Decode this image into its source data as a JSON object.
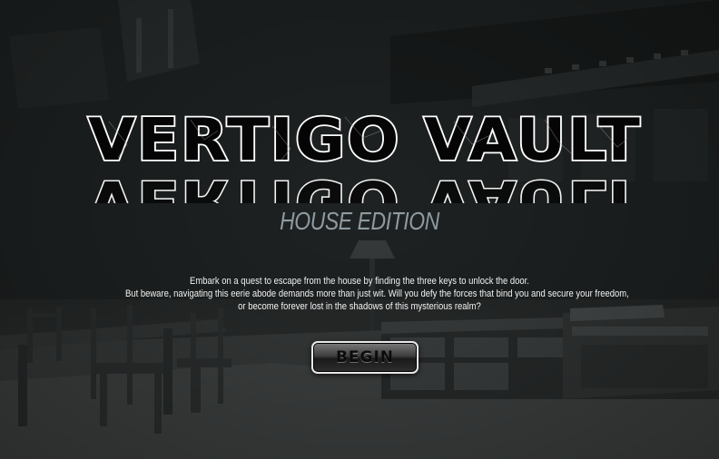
{
  "game": {
    "title": "VERTIGO VAULT",
    "subtitle": "HOUSE EDITION",
    "intro": {
      "line1": "Embark on a quest to escape from the house by finding the three keys to unlock the door.",
      "line2": "But beware, navigating this eerie abode demands more than just wit. Will you defy the forces that bind you and secure your freedom,",
      "line3": "or become forever lost in the shadows of this mysterious realm?"
    },
    "begin_button": "BEGIN"
  },
  "colors": {
    "background": "#1f2222",
    "subtitle": "#8f9aa0",
    "title_fill": "#000000",
    "title_outline": "#ffffff",
    "text": "#f2f2f2"
  }
}
